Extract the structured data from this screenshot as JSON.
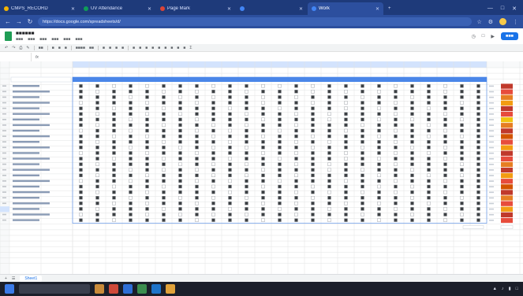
{
  "browser": {
    "tabs": [
      {
        "label": "CMPS_RECORD",
        "active": false,
        "color": "#f4b400"
      },
      {
        "label": "UV Attendance",
        "active": false,
        "color": "#0f9d58"
      },
      {
        "label": "Page Mark",
        "active": false,
        "color": "#db4437"
      },
      {
        "label": "",
        "active": false,
        "color": "#4285f4"
      },
      {
        "label": "Work",
        "active": true,
        "color": "#4285f4"
      }
    ],
    "url": "https://docs.google.com/spreadsheets/d/"
  },
  "sheet": {
    "tabs": [
      {
        "label": "Sheet1",
        "active": true
      }
    ]
  },
  "grid": {
    "rows": 25,
    "cols": 25,
    "pattern": [
      "1101011101100101111011011",
      "1011101011011101010111011",
      "1110110101101011101101111",
      "0111011011101101011011101",
      "1101101110110111010110111",
      "1011010111011010111011011",
      "1110111011101110110101101",
      "1011101101011011101110111",
      "0110111010110111011011011",
      "1101011101101101110110101",
      "1011101110111010111011111",
      "1110110101011101101101011",
      "0111011011101011011010111",
      "1101101110110111010111011",
      "1011110101011010111011101",
      "1110101011101110101101111",
      "1011011101011011110110101",
      "0110111010110111011011011",
      "1101101101101101110101111",
      "1011011110111010101011011",
      "1110110101011101111101101",
      "1101011011101011010110111",
      "1011101110110110111011011",
      "0111010101011011101101101",
      "1101111011101110110111011"
    ],
    "status_colors": [
      "#c0392b",
      "#e74c3c",
      "#e67e22",
      "#f39c12",
      "#c0392b",
      "#e74c3c",
      "#f1c40f",
      "#e67e22",
      "#c0392b",
      "#d35400",
      "#e74c3c",
      "#f39c12",
      "#c0392b",
      "#e74c3c",
      "#e67e22",
      "#c0392b",
      "#f39c12",
      "#e74c3c",
      "#d35400",
      "#c0392b",
      "#e67e22",
      "#e74c3c",
      "#f39c12",
      "#c0392b",
      "#e74c3c"
    ],
    "header_color": "#4a86e8",
    "checked_color": "#3c4043",
    "unchecked_color": "#ffffff"
  },
  "colors": {
    "browser_dark": "#1e3a7a",
    "browser_bar": "#2c4f9e",
    "accent": "#1a73e8",
    "sheets_green": "#1f9d55"
  }
}
